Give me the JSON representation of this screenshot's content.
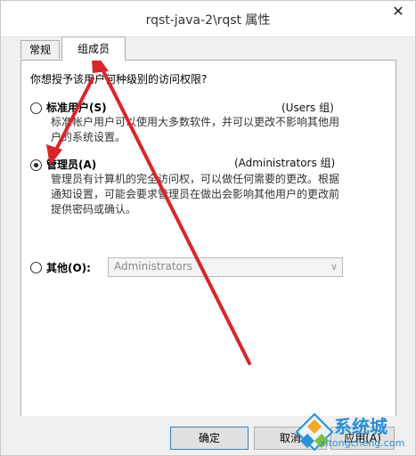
{
  "window": {
    "title": "rqst-java-2\\rqst 属性",
    "close_glyph": "✕"
  },
  "tabs": [
    {
      "label": "常规",
      "selected": false
    },
    {
      "label": "组成员",
      "selected": true
    }
  ],
  "question": "你想授予该用户何种级别的访问权限?",
  "options": {
    "standard": {
      "label": "标准用户(S)",
      "group": "(Users 组)",
      "desc": [
        "标准帐户用户可以使用大多数软件，并可以更改不影响其他用",
        "户的系统设置。"
      ],
      "selected": false
    },
    "admin": {
      "label": "管理员(A)",
      "group": "(Administrators 组)",
      "desc": [
        "管理员有计算机的完全访问权，可以做任何需要的更改。根据",
        "通知设置，可能会要求管理员在做出会影响其他用户的更改前",
        "提供密码或确认。"
      ],
      "selected": true
    },
    "other": {
      "label": "其他(O):",
      "select_value": "Administrators",
      "selected": false
    }
  },
  "buttons": {
    "ok": "确定",
    "cancel": "取消",
    "apply": "应用(A)"
  },
  "watermark": {
    "title": "系统城",
    "url": "xitongcheng.com"
  },
  "colors": {
    "annotation_arrow": "#d9252a",
    "watermark": "#2a8fd6"
  }
}
